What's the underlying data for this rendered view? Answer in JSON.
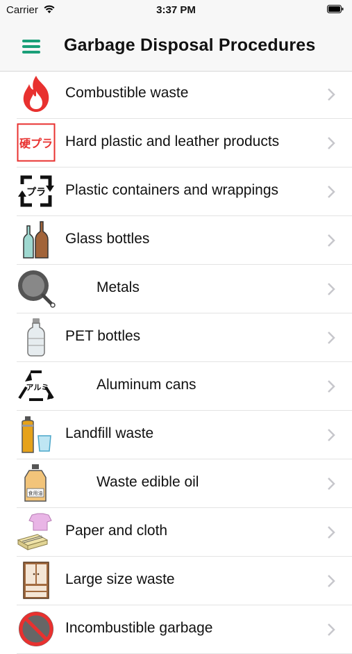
{
  "status": {
    "carrier": "Carrier",
    "time": "3:37 PM"
  },
  "nav": {
    "title": "Garbage Disposal Procedures",
    "menu_icon": "hamburger-menu-icon"
  },
  "icon_labels": {
    "hard_plastic": "硬プラ",
    "plastic_pkg": "プラ",
    "aluminum": "アルミ",
    "oil_label": "食用油"
  },
  "colors": {
    "accent": "#1a9f78",
    "fire": "#e8312f",
    "chevron": "#c7c7cc"
  },
  "items": [
    {
      "label": "Combustible waste",
      "icon": "flame-icon"
    },
    {
      "label": "Hard plastic and leather products",
      "icon": "hard-plastic-icon"
    },
    {
      "label": "Plastic containers and wrappings",
      "icon": "plastic-recycle-icon"
    },
    {
      "label": "Glass bottles",
      "icon": "glass-bottles-icon"
    },
    {
      "label": "Metals",
      "icon": "frying-pan-icon"
    },
    {
      "label": "PET bottles",
      "icon": "pet-bottle-icon"
    },
    {
      "label": "Aluminum cans",
      "icon": "aluminum-recycle-icon"
    },
    {
      "label": "Landfill waste",
      "icon": "spray-can-icon"
    },
    {
      "label": "Waste edible oil",
      "icon": "oil-bottle-icon"
    },
    {
      "label": "Paper and cloth",
      "icon": "paper-cloth-icon"
    },
    {
      "label": "Large size waste",
      "icon": "cabinet-icon"
    },
    {
      "label": "Incombustible garbage",
      "icon": "incombustible-icon"
    }
  ]
}
